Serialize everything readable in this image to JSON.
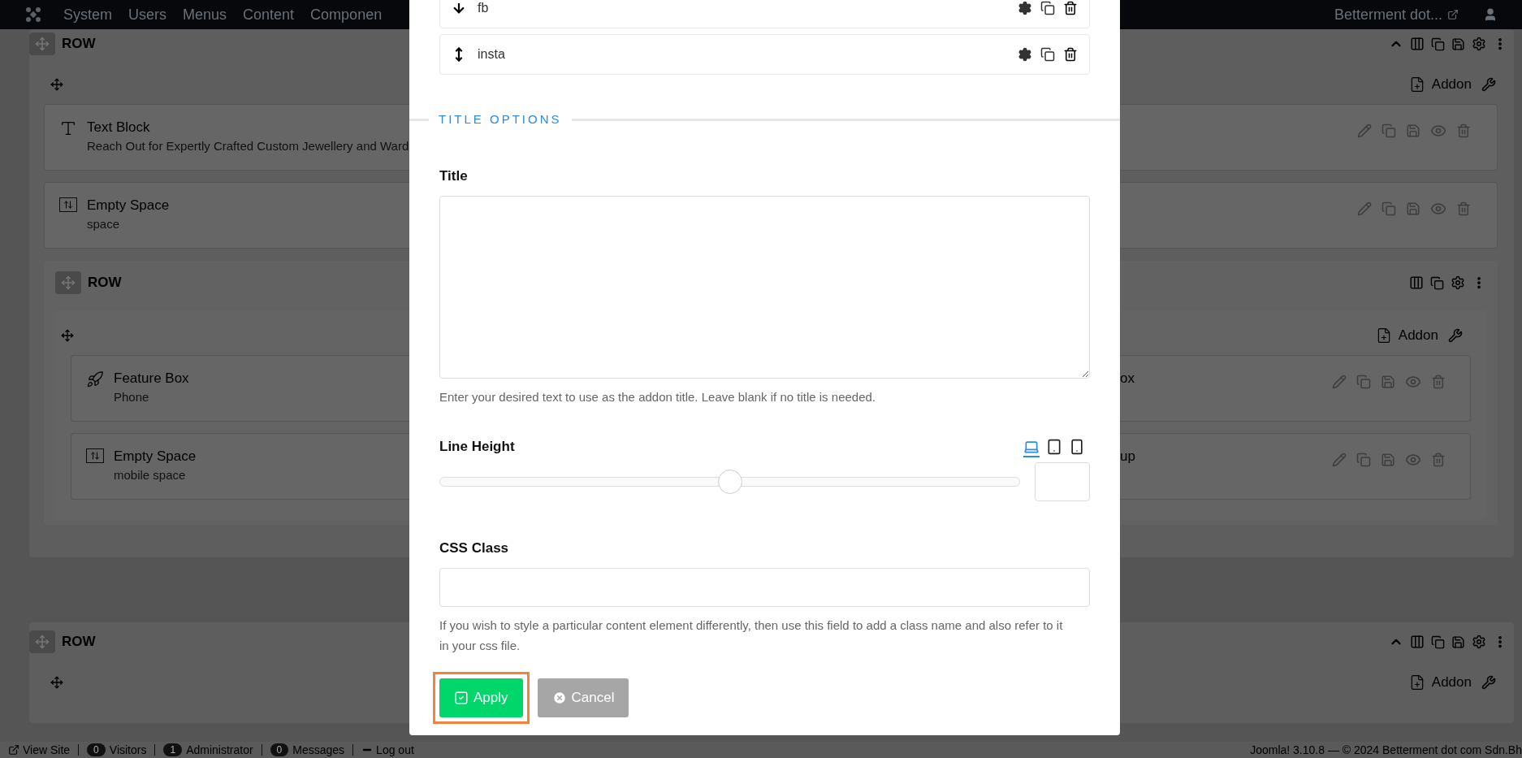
{
  "navbar": {
    "menu": [
      "System",
      "Users",
      "Menus",
      "Content",
      "Componen"
    ],
    "site": "Betterment dot..."
  },
  "sections": [
    {
      "title": "ROW",
      "addon_label": "Addon",
      "addons": [
        {
          "kind": "text",
          "title": "Text Block",
          "subtitle": "Reach Out for Expertly Crafted Custom Jewellery and Ward"
        },
        {
          "kind": "space",
          "title": "Empty Space",
          "subtitle": "space"
        }
      ],
      "inner_row": {
        "title": "ROW",
        "addon_label": "Addon",
        "addons": [
          {
            "kind": "feature",
            "title": "Feature Box",
            "subtitle": "Phone"
          },
          {
            "kind": "space",
            "title": "Empty Space",
            "subtitle": "mobile space"
          }
        ],
        "right_addons": [
          {
            "title": "ox"
          },
          {
            "title": "up"
          }
        ]
      }
    },
    {
      "title": "ROW",
      "addon_label": "Addon"
    }
  ],
  "modal": {
    "list_items": [
      {
        "label": "fb"
      },
      {
        "label": "insta"
      }
    ],
    "section_heading": "TITLE OPTIONS",
    "fields": [
      {
        "kind": "textarea",
        "label": "Title",
        "help": "Enter your desired text to use as the addon title. Leave blank if no title is needed."
      },
      {
        "kind": "slider",
        "label": "Line Height",
        "level": 0.5,
        "devices": [
          {
            "kind": "laptop",
            "selected": true
          },
          {
            "kind": "tablet",
            "selected": false
          },
          {
            "kind": "phone",
            "selected": false
          }
        ]
      },
      {
        "kind": "text",
        "label": "CSS Class",
        "help": "If you wish to style a particular content element differently, then use this field to add a class name and also refer to it in your css file."
      }
    ],
    "buttons": [
      {
        "kind": "apply",
        "label": "Apply",
        "highlighted": true
      },
      {
        "kind": "cancel",
        "label": "Cancel",
        "highlighted": false
      }
    ]
  },
  "footer": {
    "items": [
      {
        "kind": "link",
        "label": "View Site"
      },
      {
        "kind": "count",
        "count": "0",
        "label": "Visitors"
      },
      {
        "kind": "count",
        "count": "1",
        "label": "Administrator"
      },
      {
        "kind": "count",
        "count": "0",
        "label": "Messages"
      },
      {
        "kind": "logout",
        "label": "Log out"
      }
    ],
    "copyright": "Joomla! 3.10.8 — © 2024 Betterment dot com Sdn.Bh"
  }
}
